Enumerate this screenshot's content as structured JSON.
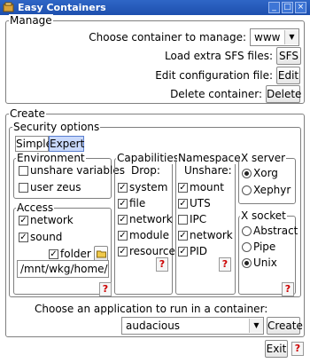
{
  "window": {
    "title": "Easy Containers"
  },
  "manage": {
    "heading": "Manage",
    "choose_label": "Choose container to manage:",
    "choose_value": "www",
    "sfs_label": "Load extra SFS files:",
    "sfs_button": "SFS",
    "edit_label": "Edit configuration file:",
    "edit_button": "Edit",
    "delete_label": "Delete container:",
    "delete_button": "Delete"
  },
  "create": {
    "heading": "Create",
    "security": {
      "heading": "Security options",
      "tabs": [
        "Simple",
        "Expert"
      ],
      "active_tab": "Expert",
      "environment": {
        "heading": "Environment",
        "items": [
          {
            "label": "unshare variables",
            "checked": false
          },
          {
            "label": "user zeus",
            "checked": false
          }
        ]
      },
      "access": {
        "heading": "Access",
        "network": {
          "label": "network",
          "checked": true
        },
        "sound": {
          "label": "sound",
          "checked": true
        },
        "folder": {
          "label": "folder",
          "checked": true
        },
        "path_value": "/mnt/wkg/home/sha"
      },
      "capabilities": {
        "heading": "Capabilities",
        "sub": "Drop:",
        "items": [
          {
            "label": "system",
            "checked": true
          },
          {
            "label": "file",
            "checked": true
          },
          {
            "label": "network",
            "checked": true
          },
          {
            "label": "module",
            "checked": true
          },
          {
            "label": "resource",
            "checked": true
          }
        ]
      },
      "namespaces": {
        "heading": "Namespaces",
        "sub": "Unshare:",
        "items": [
          {
            "label": "mount",
            "checked": true
          },
          {
            "label": "UTS",
            "checked": true
          },
          {
            "label": "IPC",
            "checked": false
          },
          {
            "label": "network",
            "checked": true
          },
          {
            "label": "PID",
            "checked": true
          }
        ]
      },
      "xserver": {
        "heading": "X server",
        "items": [
          {
            "label": "Xorg",
            "selected": true
          },
          {
            "label": "Xephyr",
            "selected": false
          }
        ]
      },
      "xsocket": {
        "heading": "X socket",
        "items": [
          {
            "label": "Abstract",
            "selected": false
          },
          {
            "label": "Pipe",
            "selected": false
          },
          {
            "label": "Unix",
            "selected": true
          }
        ]
      }
    },
    "app_label": "Choose an application to run in a container:",
    "app_value": "audacious",
    "create_button": "Create"
  },
  "footer": {
    "exit_button": "Exit"
  },
  "help_mark": "?",
  "check_mark": "✓"
}
